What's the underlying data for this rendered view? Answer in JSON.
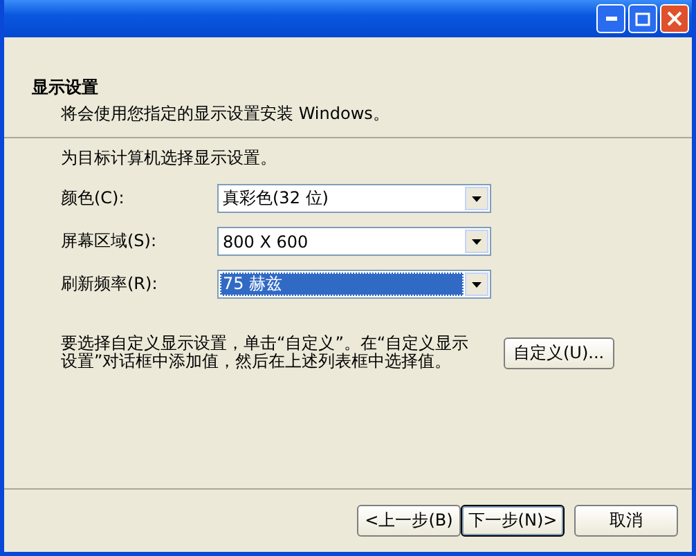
{
  "header": {
    "title": "显示设置",
    "subtitle": "将会使用您指定的显示设置安装 Windows。"
  },
  "intro": "为目标计算机选择显示设置。",
  "fields": [
    {
      "label": "颜色(C):",
      "value": "真彩色(32 位)",
      "focused": false
    },
    {
      "label": "屏幕区域(S):",
      "value": "800 X 600",
      "focused": false
    },
    {
      "label": "刷新频率(R):",
      "value": "75 赫兹",
      "focused": true
    }
  ],
  "custom": {
    "text": "要选择自定义显示设置，单击“自定义”。在“自定义显示设置”对话框中添加值，然后在上述列表框中选择值。",
    "button": "自定义(U)..."
  },
  "buttons": [
    {
      "label": "<上一步(B)",
      "default": false
    },
    {
      "label": "下一步(N)>",
      "default": true
    },
    {
      "label": "取消",
      "default": false
    }
  ]
}
